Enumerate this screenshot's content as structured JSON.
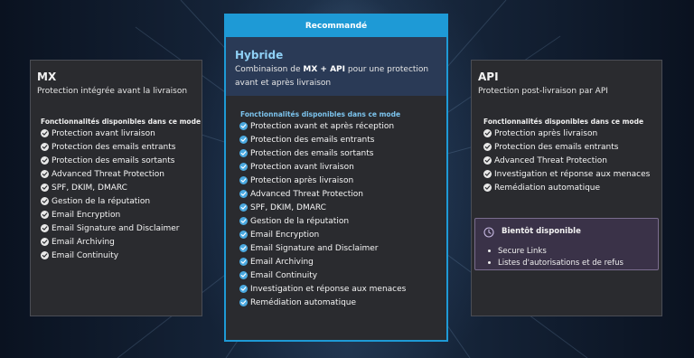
{
  "plans": {
    "mx": {
      "title": "MX",
      "subtitle": "Protection intégrée avant la livraison",
      "features_heading": "Fonctionnalités disponibles dans ce mode",
      "features": [
        "Protection avant livraison",
        "Protection des emails entrants",
        "Protection des emails sortants",
        "Advanced Threat Protection",
        "SPF, DKIM, DMARC",
        "Gestion de la réputation",
        "Email Encryption",
        "Email Signature and Disclaimer",
        "Email Archiving",
        "Email Continuity"
      ]
    },
    "hybrid": {
      "badge": "Recommandé",
      "title": "Hybride",
      "subtitle_pre": "Combinaison de ",
      "subtitle_bold": "MX + API",
      "subtitle_post": " pour une protection avant et après livraison",
      "features_heading": "Fonctionnalités disponibles dans ce mode",
      "features": [
        "Protection avant et après réception",
        "Protection des emails entrants",
        "Protection des emails sortants",
        "Protection avant livraison",
        "Protection après livraison",
        "Advanced Threat Protection",
        "SPF, DKIM, DMARC",
        "Gestion de la réputation",
        "Email Encryption",
        "Email Signature and Disclaimer",
        "Email Archiving",
        "Email Continuity",
        "Investigation et réponse aux menaces",
        "Remédiation automatique"
      ]
    },
    "api": {
      "title": "API",
      "subtitle": "Protection post-livraison par API",
      "features_heading": "Fonctionnalités disponibles dans ce mode",
      "features": [
        "Protection après livraison",
        "Protection des emails entrants",
        "Advanced Threat Protection",
        "Investigation et réponse aux menaces",
        "Remédiation automatique"
      ],
      "coming_soon": {
        "icon": "clock-icon",
        "title": "Bientôt disponible",
        "items": [
          "Secure Links",
          "Listes d'autorisations et de refus"
        ]
      }
    }
  },
  "colors": {
    "accent": "#1e9ad6",
    "card_bg": "#2a2b2f",
    "hybrid_header_bg": "#2a3a56",
    "coming_soon_bg": "#3a3248"
  },
  "icons": {
    "feature_check": "check-circle-icon"
  }
}
